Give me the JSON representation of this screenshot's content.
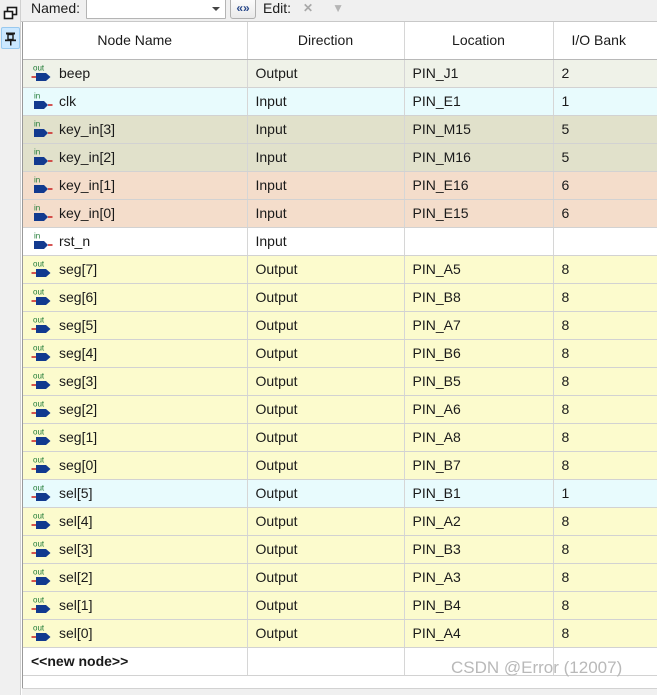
{
  "toolbar": {
    "named_label": "Named:",
    "named_value": "",
    "edit_label": "Edit:",
    "code_button": "«»",
    "close_button": "✕",
    "dropdown_button": "▼"
  },
  "leftbar": {
    "restore_icon": "restore-window-icon",
    "pin_icon": "pin-icon"
  },
  "table": {
    "columns": [
      "Node Name",
      "Direction",
      "Location",
      "I/O Bank"
    ],
    "new_node_label": "<<new node>>",
    "rows": [
      {
        "dir_icon": "out",
        "name": "beep",
        "direction": "Output",
        "location": "PIN_J1",
        "bank": "2",
        "bg": "#eff2e8"
      },
      {
        "dir_icon": "in",
        "name": "clk",
        "direction": "Input",
        "location": "PIN_E1",
        "bank": "1",
        "bg": "#e8fbfd"
      },
      {
        "dir_icon": "in",
        "name": "key_in[3]",
        "direction": "Input",
        "location": "PIN_M15",
        "bank": "5",
        "bg": "#e1e1cb"
      },
      {
        "dir_icon": "in",
        "name": "key_in[2]",
        "direction": "Input",
        "location": "PIN_M16",
        "bank": "5",
        "bg": "#e1e1cb"
      },
      {
        "dir_icon": "in",
        "name": "key_in[1]",
        "direction": "Input",
        "location": "PIN_E16",
        "bank": "6",
        "bg": "#f4ddcb"
      },
      {
        "dir_icon": "in",
        "name": "key_in[0]",
        "direction": "Input",
        "location": "PIN_E15",
        "bank": "6",
        "bg": "#f4ddcb"
      },
      {
        "dir_icon": "in",
        "name": "rst_n",
        "direction": "Input",
        "location": "",
        "bank": "",
        "bg": "#ffffff"
      },
      {
        "dir_icon": "out",
        "name": "seg[7]",
        "direction": "Output",
        "location": "PIN_A5",
        "bank": "8",
        "bg": "#fcfbcd"
      },
      {
        "dir_icon": "out",
        "name": "seg[6]",
        "direction": "Output",
        "location": "PIN_B8",
        "bank": "8",
        "bg": "#fcfbcd"
      },
      {
        "dir_icon": "out",
        "name": "seg[5]",
        "direction": "Output",
        "location": "PIN_A7",
        "bank": "8",
        "bg": "#fcfbcd"
      },
      {
        "dir_icon": "out",
        "name": "seg[4]",
        "direction": "Output",
        "location": "PIN_B6",
        "bank": "8",
        "bg": "#fcfbcd"
      },
      {
        "dir_icon": "out",
        "name": "seg[3]",
        "direction": "Output",
        "location": "PIN_B5",
        "bank": "8",
        "bg": "#fcfbcd"
      },
      {
        "dir_icon": "out",
        "name": "seg[2]",
        "direction": "Output",
        "location": "PIN_A6",
        "bank": "8",
        "bg": "#fcfbcd"
      },
      {
        "dir_icon": "out",
        "name": "seg[1]",
        "direction": "Output",
        "location": "PIN_A8",
        "bank": "8",
        "bg": "#fcfbcd"
      },
      {
        "dir_icon": "out",
        "name": "seg[0]",
        "direction": "Output",
        "location": "PIN_B7",
        "bank": "8",
        "bg": "#fcfbcd"
      },
      {
        "dir_icon": "out",
        "name": "sel[5]",
        "direction": "Output",
        "location": "PIN_B1",
        "bank": "1",
        "bg": "#e8fbfd"
      },
      {
        "dir_icon": "out",
        "name": "sel[4]",
        "direction": "Output",
        "location": "PIN_A2",
        "bank": "8",
        "bg": "#fcfbcd"
      },
      {
        "dir_icon": "out",
        "name": "sel[3]",
        "direction": "Output",
        "location": "PIN_B3",
        "bank": "8",
        "bg": "#fcfbcd"
      },
      {
        "dir_icon": "out",
        "name": "sel[2]",
        "direction": "Output",
        "location": "PIN_A3",
        "bank": "8",
        "bg": "#fcfbcd"
      },
      {
        "dir_icon": "out",
        "name": "sel[1]",
        "direction": "Output",
        "location": "PIN_B4",
        "bank": "8",
        "bg": "#fcfbcd"
      },
      {
        "dir_icon": "out",
        "name": "sel[0]",
        "direction": "Output",
        "location": "PIN_A4",
        "bank": "8",
        "bg": "#fcfbcd"
      }
    ]
  },
  "watermark": {
    "text": "CSDN @Error (12007)"
  }
}
